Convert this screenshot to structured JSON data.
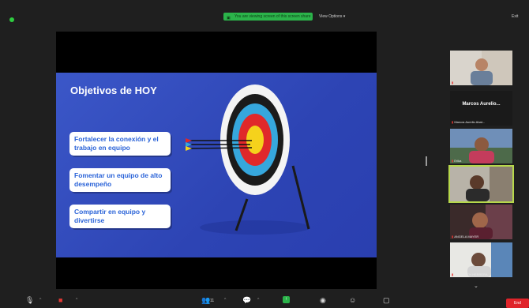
{
  "topbar": {
    "sharing_text": "You are viewing screen of this screen share",
    "view_options": "View Options ▾",
    "top_right": "Exit"
  },
  "slide": {
    "title": "Objetivos de HOY",
    "objectives": [
      "Fortalecer la conexión y el trabajo en equipo",
      "Fomentar un equipo de alto desempeño",
      "Compartir en equipo y divertirse"
    ]
  },
  "participants": {
    "name_tile_big": "Marcos Aurelio...",
    "name_tile_small": "Marcos Aurelio Abat...",
    "tile_labels": [
      "",
      "Erika",
      "",
      "ANGELA MAYER",
      "ELIZABETH HERRERA"
    ]
  },
  "bottombar": {
    "participant_count": "11",
    "end_label": "End"
  },
  "colors": {
    "accent_green": "#2bb34a",
    "slide_blue": "#2d44b4",
    "objective_text": "#2a63d8",
    "end_red": "#e0242a"
  },
  "icons": [
    "mic-icon",
    "camera-icon",
    "participants-icon",
    "chat-icon",
    "share-screen-icon",
    "record-icon",
    "reactions-icon",
    "more-icon"
  ]
}
